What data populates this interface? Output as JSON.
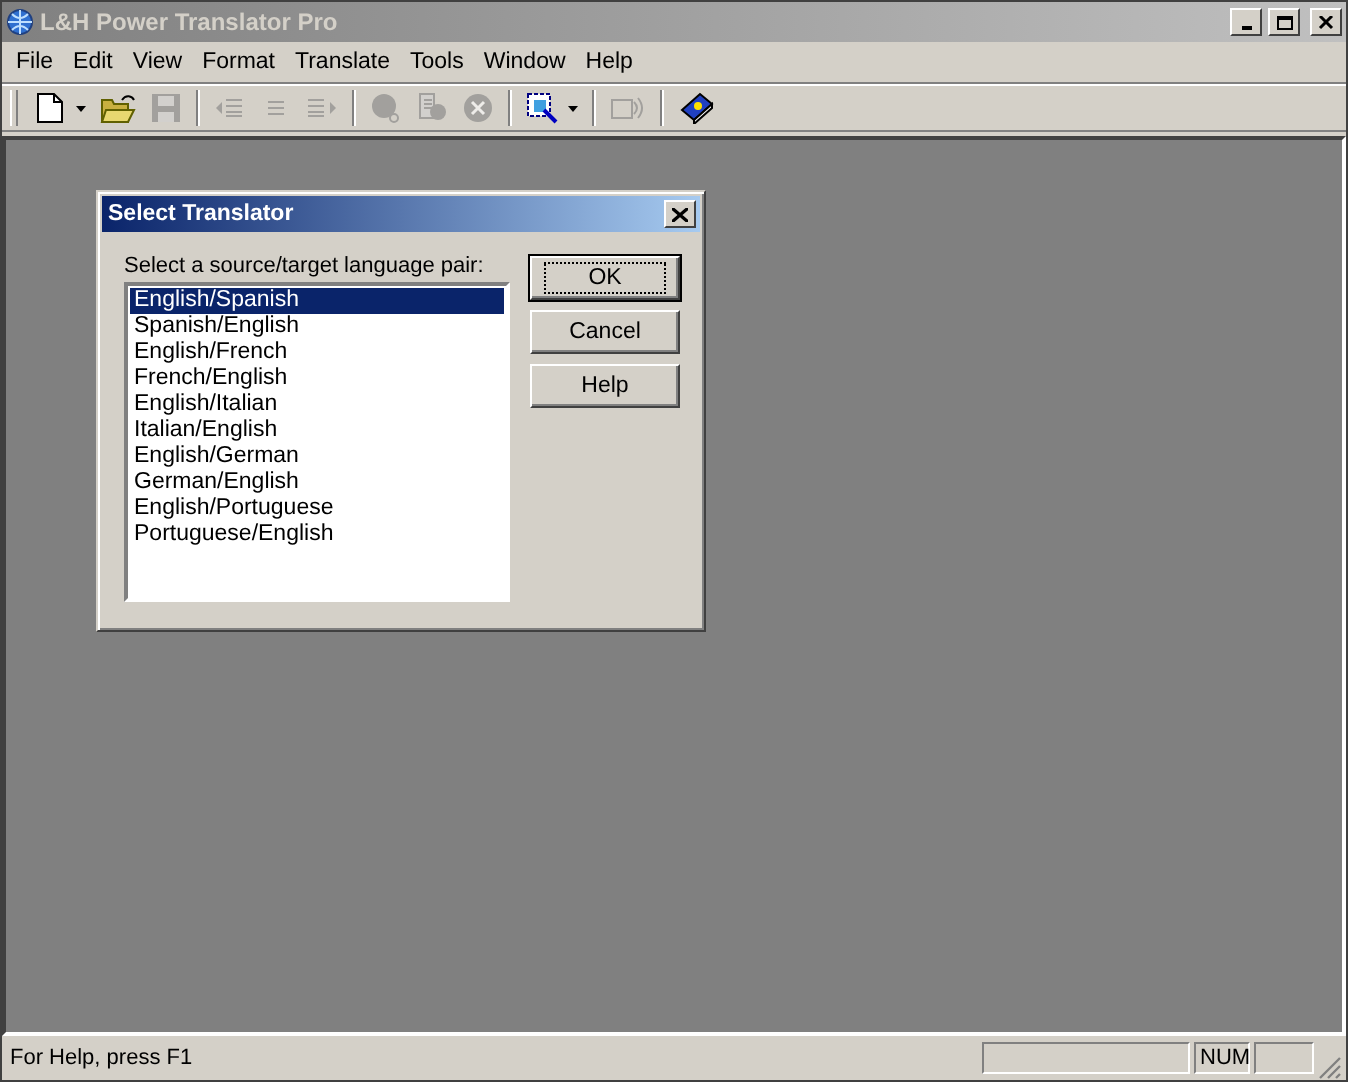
{
  "window": {
    "title": "L&H Power Translator Pro",
    "active": false
  },
  "menu": [
    "File",
    "Edit",
    "View",
    "Format",
    "Translate",
    "Tools",
    "Window",
    "Help"
  ],
  "toolbar": [
    {
      "kind": "new",
      "disabled": false
    },
    {
      "kind": "dropdown",
      "disabled": false
    },
    {
      "kind": "open",
      "disabled": false
    },
    {
      "kind": "save",
      "disabled": true
    },
    {
      "kind": "separator"
    },
    {
      "kind": "prev",
      "disabled": true
    },
    {
      "kind": "current",
      "disabled": true
    },
    {
      "kind": "next",
      "disabled": true
    },
    {
      "kind": "separator"
    },
    {
      "kind": "search",
      "disabled": true
    },
    {
      "kind": "search-doc",
      "disabled": true
    },
    {
      "kind": "stop",
      "disabled": true
    },
    {
      "kind": "separator"
    },
    {
      "kind": "select",
      "disabled": false
    },
    {
      "kind": "dropdown",
      "disabled": false
    },
    {
      "kind": "separator"
    },
    {
      "kind": "speak",
      "disabled": true
    },
    {
      "kind": "separator"
    },
    {
      "kind": "book",
      "disabled": false
    }
  ],
  "dialog": {
    "title": "Select Translator",
    "label": "Select a source/target language pair:",
    "items": [
      {
        "label": "English/Spanish",
        "selected": true
      },
      {
        "label": "Spanish/English",
        "selected": false
      },
      {
        "label": "English/French",
        "selected": false
      },
      {
        "label": "French/English",
        "selected": false
      },
      {
        "label": "English/Italian",
        "selected": false
      },
      {
        "label": "Italian/English",
        "selected": false
      },
      {
        "label": "English/German",
        "selected": false
      },
      {
        "label": "German/English",
        "selected": false
      },
      {
        "label": "English/Portuguese",
        "selected": false
      },
      {
        "label": "Portuguese/English",
        "selected": false
      }
    ],
    "buttons": [
      {
        "label": "OK",
        "default": true
      },
      {
        "label": "Cancel",
        "default": false
      },
      {
        "label": "Help",
        "default": false
      }
    ]
  },
  "status_bar": {
    "text": "For Help, press F1",
    "num": "NUM"
  }
}
